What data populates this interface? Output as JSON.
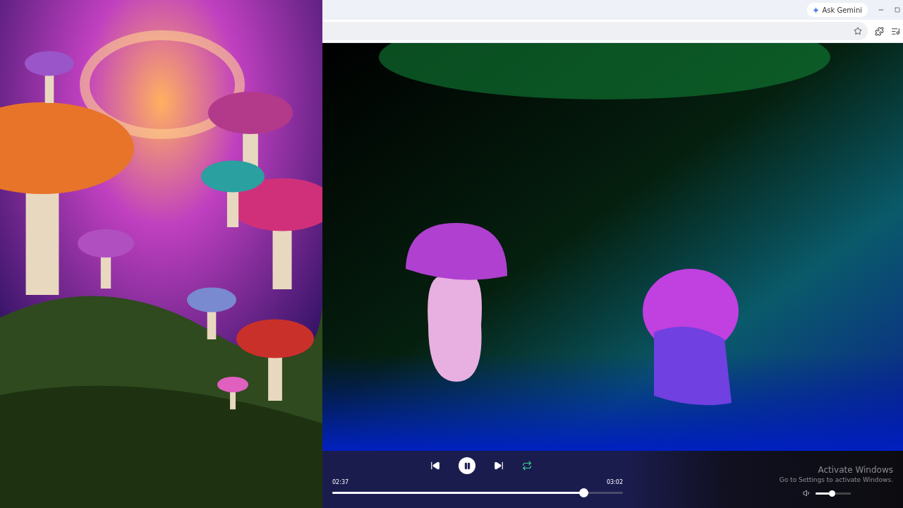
{
  "browser": {
    "gemini_button": "Ask Gemini",
    "bookmarked": false
  },
  "player": {
    "playing": true,
    "repeat": true,
    "elapsed": "02:37",
    "duration": "03:02",
    "level": 0.864,
    "volume": {
      "level": 0.45
    }
  },
  "activation_notice": {
    "title": "Activate Windows",
    "body": "Go to Settings to activate Windows."
  }
}
